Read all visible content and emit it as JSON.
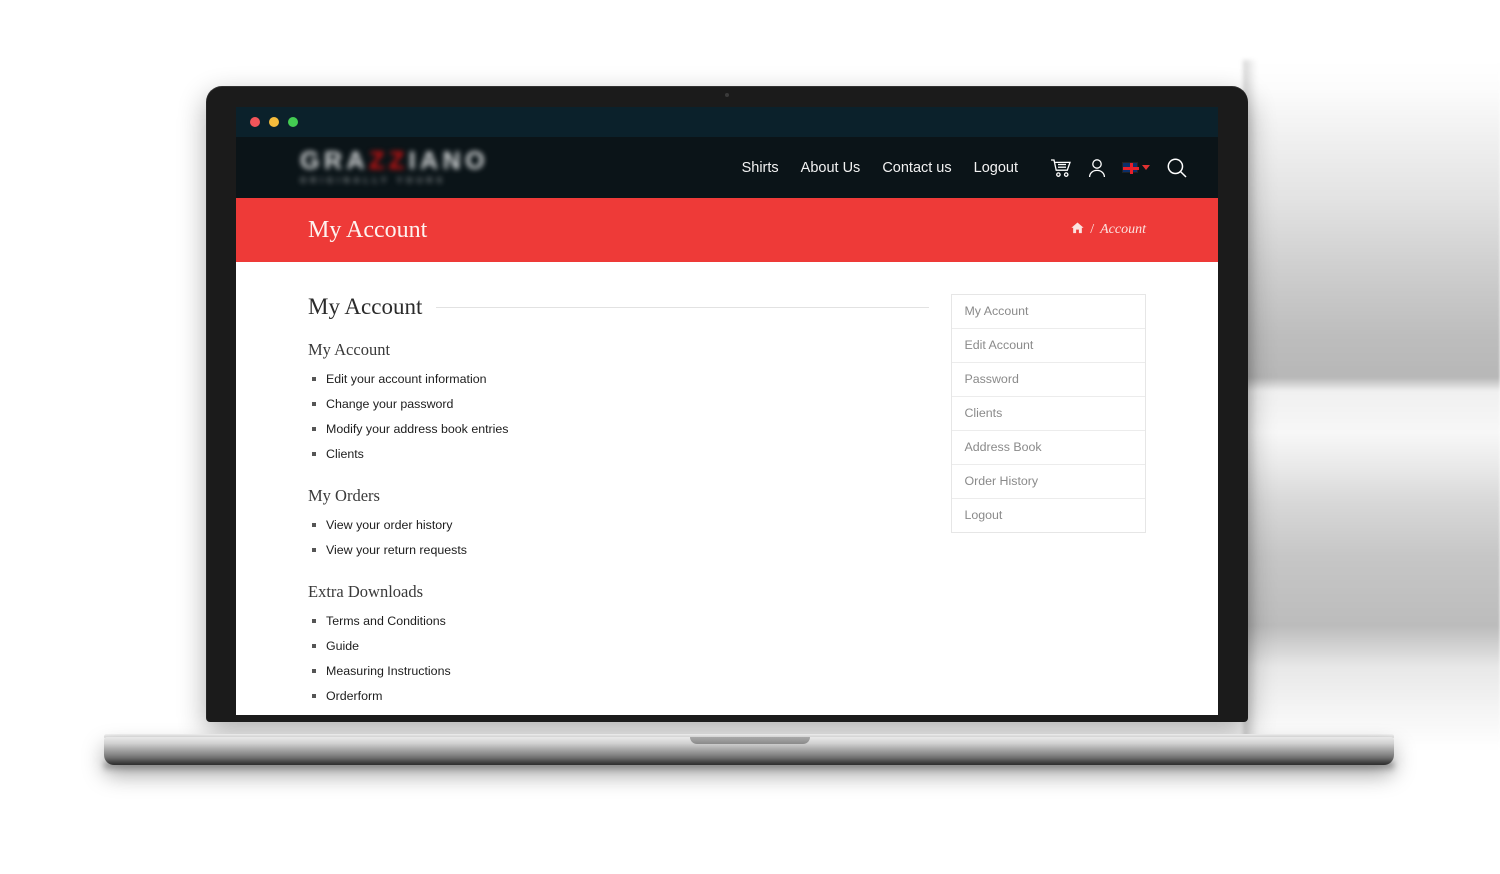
{
  "window": {
    "traffic_lights": [
      "close",
      "minimize",
      "maximize"
    ]
  },
  "site": {
    "logo": {
      "main_prefix": "GRA",
      "main_accent": "ZZ",
      "main_suffix": "IANO",
      "tagline": "ORIGINALLY YOURS",
      "accent_color": "#cc1111"
    },
    "nav": [
      {
        "label": "Shirts",
        "name": "nav-shirts"
      },
      {
        "label": "About Us",
        "name": "nav-about-us"
      },
      {
        "label": "Contact us",
        "name": "nav-contact-us"
      },
      {
        "label": "Logout",
        "name": "nav-logout"
      }
    ],
    "icons": {
      "cart": "shopping-cart-icon",
      "account": "user-account-icon",
      "language": "flag-icon",
      "search": "search-icon"
    }
  },
  "banner": {
    "title": "My Account",
    "background": "#ee3a38",
    "breadcrumb": {
      "home": "⌂",
      "separator": "/",
      "current": "Account"
    }
  },
  "main": {
    "page_heading": "My Account",
    "sections": [
      {
        "title": "My Account",
        "name": "section-my-account",
        "items": [
          "Edit your account information",
          "Change your password",
          "Modify your address book entries",
          "Clients"
        ]
      },
      {
        "title": "My Orders",
        "name": "section-my-orders",
        "items": [
          "View your order history",
          "View your return requests"
        ]
      },
      {
        "title": "Extra Downloads",
        "name": "section-extra-downloads",
        "items": [
          "Terms and Conditions",
          "Guide",
          "Measuring Instructions",
          "Orderform"
        ]
      }
    ]
  },
  "sidebar": {
    "items": [
      "My Account",
      "Edit Account",
      "Password",
      "Clients",
      "Address Book",
      "Order History",
      "Logout"
    ]
  }
}
